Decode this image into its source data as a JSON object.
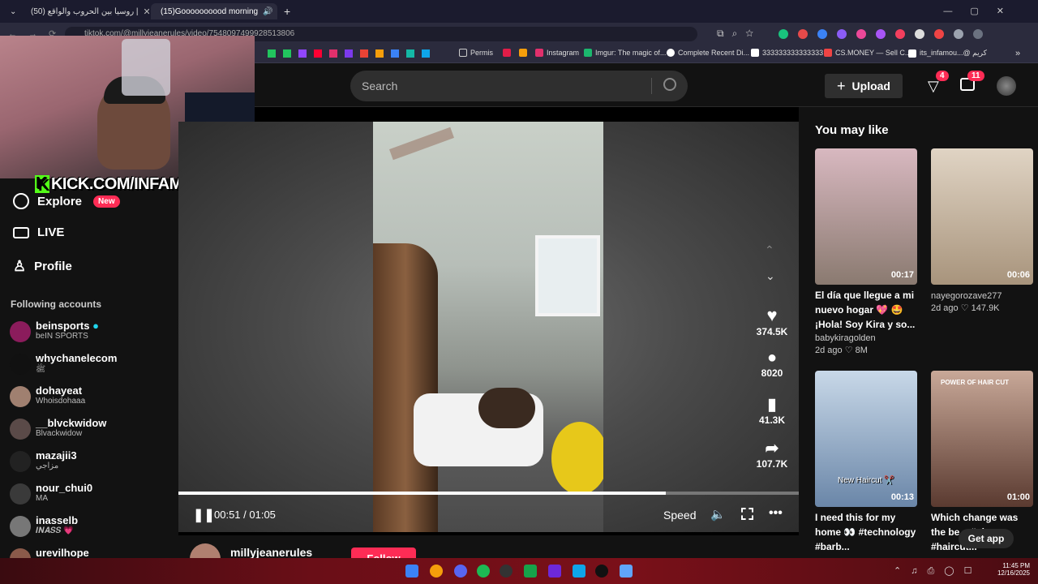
{
  "browser": {
    "tabs": [
      {
        "title": "(50) روسيا بين الحروب والواقع |",
        "active": false,
        "favicon_color": "#ff0033"
      },
      {
        "title": "(15)Goooooooood morning",
        "active": true,
        "favicon_color": "#ffffff"
      }
    ],
    "new_tab": "+",
    "url": "tiktok.com/@millyjeanerules/video/7548097499928513806",
    "bookmarks": [
      {
        "label": "Permis",
        "icon": "folder-icon"
      },
      {
        "label": "Instagram",
        "icon": "chart-icon"
      },
      {
        "label": "Imgur: The magic of...",
        "icon": "imgur-icon"
      },
      {
        "label": "Complete Recent Di...",
        "icon": "github-icon"
      },
      {
        "label": "333333333333333",
        "icon": "x-icon"
      },
      {
        "label": "CS.MONEY — Sell C...",
        "icon": "csmoney-icon"
      },
      {
        "label": "its_infamou...@ كريم",
        "icon": "tiktok-icon"
      }
    ]
  },
  "header": {
    "search_placeholder": "Search",
    "upload_label": "Upload",
    "inbox_badge": "4",
    "messages_badge": "11"
  },
  "sidebar": {
    "nav": [
      {
        "label": "Explore",
        "pill": "New",
        "icon": "compass-icon"
      },
      {
        "label": "LIVE",
        "icon": "live-icon"
      },
      {
        "label": "Profile",
        "icon": "person-icon"
      }
    ],
    "following_title": "Following accounts",
    "accounts": [
      {
        "name": "beinsports",
        "sub": "beIN SPORTS",
        "verified": true
      },
      {
        "name": "whychanelecom",
        "sub": "ﷺ"
      },
      {
        "name": "dohayeat",
        "sub": "Whoisdohaaa"
      },
      {
        "name": "__blvckwidow",
        "sub": "Blvackwidow"
      },
      {
        "name": "mazajii3",
        "sub": "مزاجي"
      },
      {
        "name": "nour_chui0",
        "sub": "MA"
      },
      {
        "name": "inasselb",
        "sub": "𝑰𝑵𝑨𝑺𝑺 💗"
      },
      {
        "name": "urevilhope",
        "sub": ""
      }
    ]
  },
  "overlay": {
    "kick_text": "KICK.COM/INFAMOUSS"
  },
  "player": {
    "time": "00:51 / 01:05",
    "progress_fraction": 0.785,
    "speed_label": "Speed",
    "actions": [
      {
        "icon": "heart-icon",
        "count": "374.5K"
      },
      {
        "icon": "comment-icon",
        "count": "8020"
      },
      {
        "icon": "bookmark-icon",
        "count": "41.3K"
      },
      {
        "icon": "share-icon",
        "count": "107.7K"
      }
    ],
    "author": "millyjeanerules",
    "follow_label": "Follow"
  },
  "you_may_like": {
    "title": "You may like",
    "cards": [
      {
        "duration": "00:17",
        "title": "El día que llegue a mi nuevo hogar 💖 🤩 ¡Hola! Soy Kira y so...",
        "user": "babykiragolden",
        "ago": "2d ago",
        "likes": "8M",
        "thumb": "#b8a6a1"
      },
      {
        "duration": "00:06",
        "title": "",
        "user": "nayegorozave277",
        "ago": "2d ago",
        "likes": "147.9K",
        "thumb": "#d6c8b6"
      },
      {
        "duration": "00:13",
        "title": "I need this for my home 👀 #technology #barb...",
        "user": "",
        "ago": "",
        "likes": "",
        "thumb": "#8fa6c4",
        "caption": "New Haircut ✂️"
      },
      {
        "duration": "01:00",
        "title": "Which change was the be... #glowup #haircut...",
        "user": "",
        "ago": "",
        "likes": "",
        "thumb": "#7e5a4f",
        "caption": "POWER OF HAIR CUT"
      }
    ],
    "get_app": "Get app"
  },
  "taskbar": {
    "time": "11:45 PM",
    "date": "12/16/2025"
  }
}
